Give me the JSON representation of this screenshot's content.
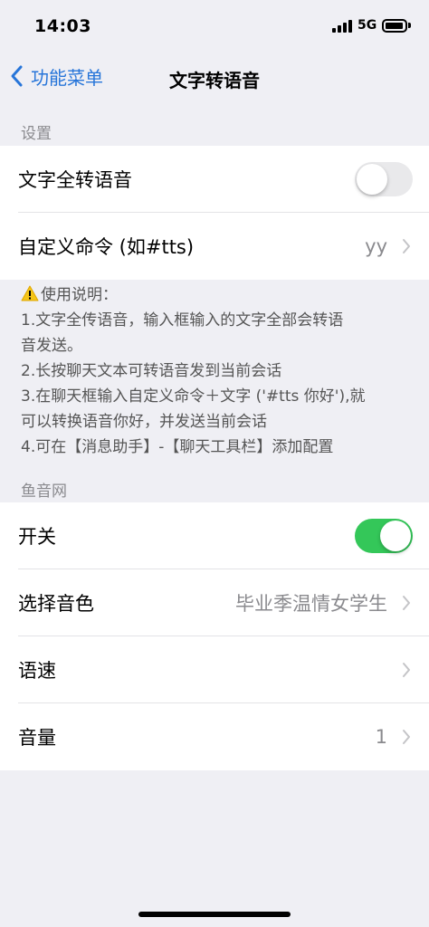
{
  "status_bar": {
    "time": "14:03",
    "network": "5G"
  },
  "nav": {
    "back_label": "功能菜单",
    "title": "文字转语音"
  },
  "settings_section": {
    "header": "设置",
    "rows": [
      {
        "label": "文字全转语音",
        "control": "toggle",
        "on": false
      },
      {
        "label": "自定义命令 (如#tts)",
        "value": "yy",
        "control": "chevron"
      }
    ]
  },
  "instructions": {
    "title": "使用说明：",
    "lines": [
      "1.文字全传语音，输入框输入的文字全部会转语",
      "音发送。",
      "2.长按聊天文本可转语音发到当前会话",
      "3.在聊天框输入自定义命令＋文字 ('#tts 你好'),就",
      "可以转换语音你好，并发送当前会话",
      "4.可在【消息助手】-【聊天工具栏】添加配置"
    ]
  },
  "yuyin_section": {
    "header": "鱼音网",
    "rows": [
      {
        "label": "开关",
        "control": "toggle",
        "on": true
      },
      {
        "label": "选择音色",
        "value": "毕业季温情女学生",
        "control": "chevron"
      },
      {
        "label": "语速",
        "value": "",
        "control": "chevron"
      },
      {
        "label": "音量",
        "value": "1",
        "control": "chevron"
      }
    ]
  },
  "colors": {
    "accent": "#2775d9",
    "toggle_on": "#34c759",
    "background": "#efeff4"
  }
}
